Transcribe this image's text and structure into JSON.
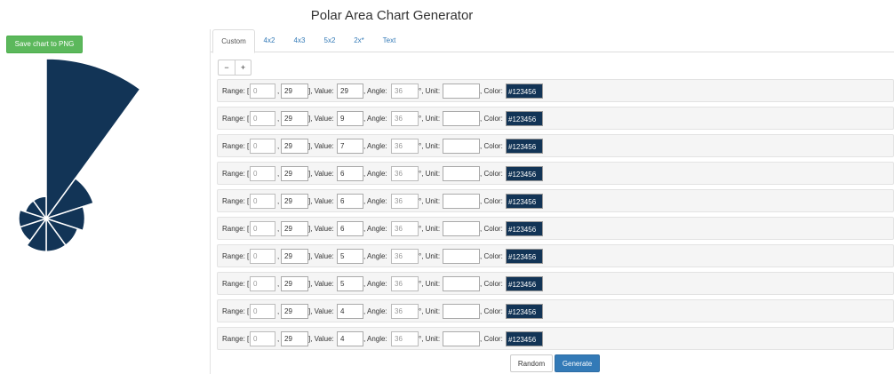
{
  "page": {
    "title": "Polar Area Chart Generator",
    "save_label": "Save chart to PNG"
  },
  "tabs": [
    {
      "label": "Custom",
      "active": true
    },
    {
      "label": "4x2",
      "active": false
    },
    {
      "label": "4x3",
      "active": false
    },
    {
      "label": "5x2",
      "active": false
    },
    {
      "label": "2x*",
      "active": false
    },
    {
      "label": "Text",
      "active": false
    }
  ],
  "stepper": {
    "minus": "−",
    "plus": "+"
  },
  "row_labels": {
    "range": "Range: [",
    "range_sep": ",",
    "value": "], Value:",
    "angle": ", Angle:",
    "unit": "°, Unit:",
    "color": ", Color:"
  },
  "rows": [
    {
      "range_min": "0",
      "range_max": "29",
      "value": "29",
      "angle": "36",
      "unit": "",
      "color": "#123456"
    },
    {
      "range_min": "0",
      "range_max": "29",
      "value": "9",
      "angle": "36",
      "unit": "",
      "color": "#123456"
    },
    {
      "range_min": "0",
      "range_max": "29",
      "value": "7",
      "angle": "36",
      "unit": "",
      "color": "#123456"
    },
    {
      "range_min": "0",
      "range_max": "29",
      "value": "6",
      "angle": "36",
      "unit": "",
      "color": "#123456"
    },
    {
      "range_min": "0",
      "range_max": "29",
      "value": "6",
      "angle": "36",
      "unit": "",
      "color": "#123456"
    },
    {
      "range_min": "0",
      "range_max": "29",
      "value": "6",
      "angle": "36",
      "unit": "",
      "color": "#123456"
    },
    {
      "range_min": "0",
      "range_max": "29",
      "value": "5",
      "angle": "36",
      "unit": "",
      "color": "#123456"
    },
    {
      "range_min": "0",
      "range_max": "29",
      "value": "5",
      "angle": "36",
      "unit": "",
      "color": "#123456"
    },
    {
      "range_min": "0",
      "range_max": "29",
      "value": "4",
      "angle": "36",
      "unit": "",
      "color": "#123456"
    },
    {
      "range_min": "0",
      "range_max": "29",
      "value": "4",
      "angle": "36",
      "unit": "",
      "color": "#123456"
    }
  ],
  "buttons": {
    "random": "Random",
    "generate": "Generate"
  },
  "chart_data": {
    "type": "polar-area",
    "range": [
      0,
      29
    ],
    "values": [
      29,
      9,
      7,
      6,
      6,
      6,
      5,
      5,
      4,
      4
    ],
    "angles": [
      36,
      36,
      36,
      36,
      36,
      36,
      36,
      36,
      36,
      36
    ],
    "colors": [
      "#123456",
      "#123456",
      "#123456",
      "#123456",
      "#123456",
      "#123456",
      "#123456",
      "#123456",
      "#123456",
      "#123456"
    ],
    "separator_color": "#ffffff"
  }
}
